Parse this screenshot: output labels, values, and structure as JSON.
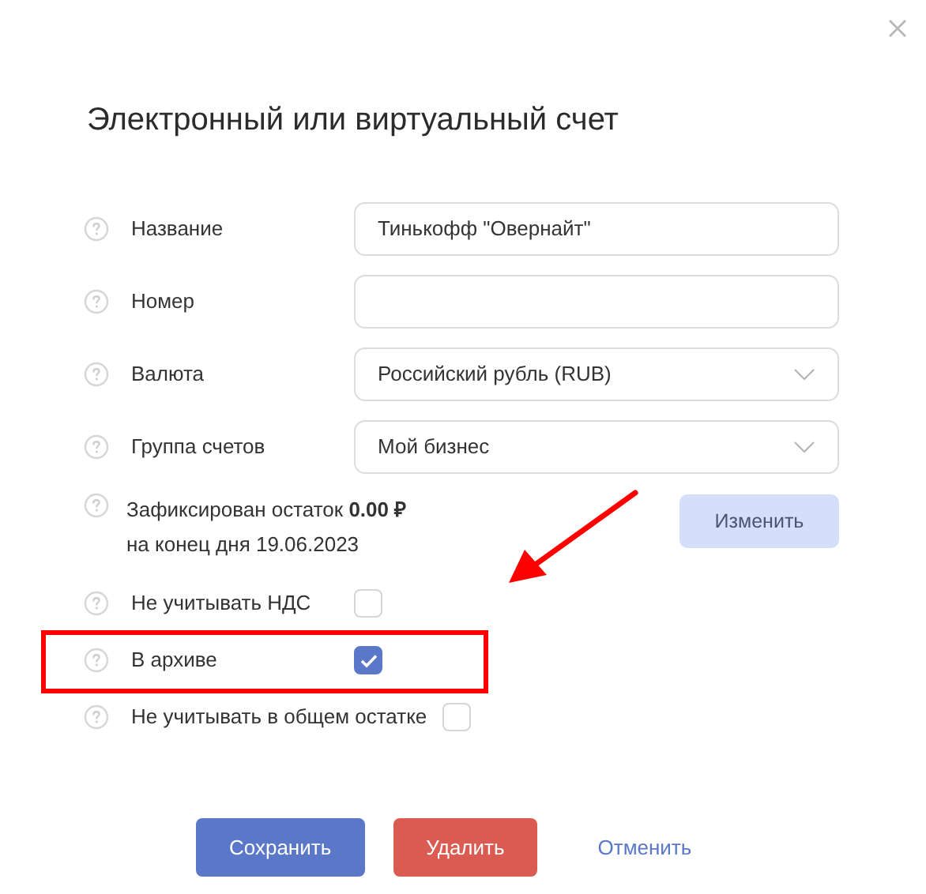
{
  "title": "Электронный или виртуальный счет",
  "fields": [
    {
      "label": "Название",
      "kind": "text",
      "value": "Тинькофф \"Овернайт\""
    },
    {
      "label": "Номер",
      "kind": "text"
    },
    {
      "label": "Валюта",
      "kind": "select",
      "value": "Российский рубль (RUB)"
    },
    {
      "label": "Группа счетов",
      "kind": "select",
      "value": "Мой бизнес"
    }
  ],
  "balance": {
    "lines": [
      "Зафиксирован остаток **0.00 ₽**",
      "на конец дня 19.06.2023"
    ],
    "button": "Изменить"
  },
  "options": [
    {
      "label": "Не учитывать НДС",
      "checked": false,
      "highlighted": false
    },
    {
      "label": "В архиве",
      "checked": true,
      "highlighted": true
    },
    {
      "label": "Не учитывать в общем остатке",
      "checked": false,
      "highlighted": false
    }
  ],
  "buttons": [
    {
      "label": "Сохранить",
      "kind": "primary"
    },
    {
      "label": "Удалить",
      "kind": "danger"
    },
    {
      "label": "Отменить",
      "kind": "link"
    }
  ]
}
